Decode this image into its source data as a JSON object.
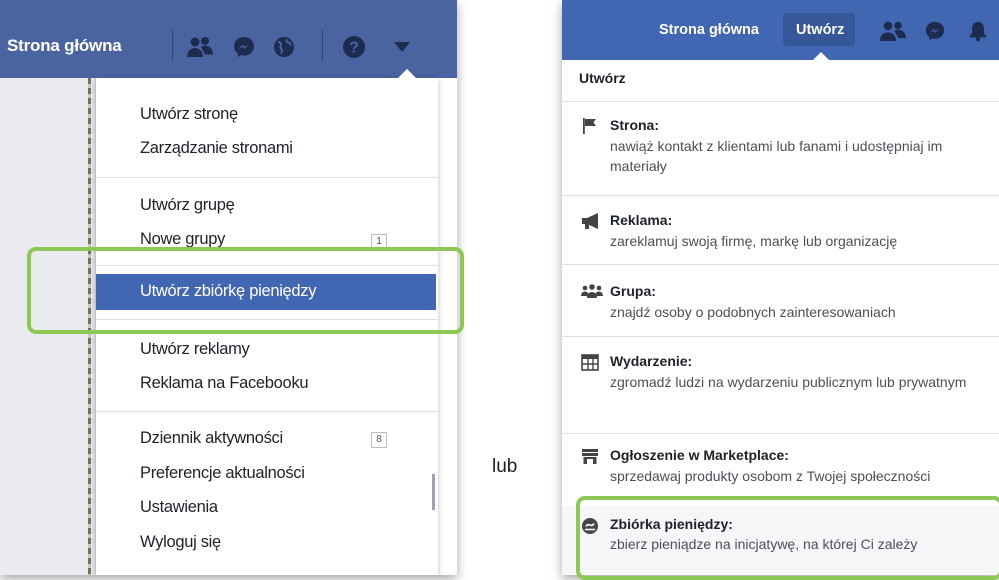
{
  "left": {
    "nav_home": "Strona główna",
    "icons": [
      "friends-icon",
      "messenger-icon",
      "globe-icon",
      "help-icon",
      "dropdown-arrow-icon"
    ],
    "menu": [
      {
        "label": "Utwórz stronę"
      },
      {
        "label": "Zarządzanie stronami"
      },
      {
        "label": "Utwórz grupę"
      },
      {
        "label": "Nowe grupy",
        "badge": "1"
      },
      {
        "label": "Utwórz zbiórkę pieniędzy",
        "highlighted": true
      },
      {
        "label": "Utwórz reklamy"
      },
      {
        "label": "Reklama na Facebooku"
      },
      {
        "label": "Dziennik aktywności",
        "badge": "8"
      },
      {
        "label": "Preferencje aktualności"
      },
      {
        "label": "Ustawienia"
      },
      {
        "label": "Wyloguj się"
      }
    ]
  },
  "separator_text": "lub",
  "right": {
    "nav_home": "Strona główna",
    "nav_create": "Utwórz",
    "icons": [
      "friends-icon",
      "messenger-icon",
      "notifications-icon"
    ],
    "header": "Utwórz",
    "items": [
      {
        "title": "Strona:",
        "desc": "nawiąż kontakt z klientami lub fanami i udostępniaj im materiały",
        "icon": "flag-icon"
      },
      {
        "title": "Reklama:",
        "desc": "zareklamuj swoją firmę, markę lub organizację",
        "icon": "megaphone-icon"
      },
      {
        "title": "Grupa:",
        "desc": "znajdź osoby o podobnych zainteresowaniach",
        "icon": "group-icon"
      },
      {
        "title": "Wydarzenie:",
        "desc": "zgromadź ludzi na wydarzeniu publicznym lub prywatnym",
        "icon": "calendar-icon"
      },
      {
        "title": "Ogłoszenie w Marketplace:",
        "desc": "sprzedawaj produkty osobom z Twojej społeczności",
        "icon": "shop-icon"
      },
      {
        "title": "Zbiórka pieniędzy:",
        "desc": "zbierz pieniądze na inicjatywę, na której Ci zależy",
        "icon": "fundraiser-icon"
      }
    ]
  },
  "colors": {
    "facebook_blue": "#4267b2",
    "highlight_green": "#8dc855"
  }
}
